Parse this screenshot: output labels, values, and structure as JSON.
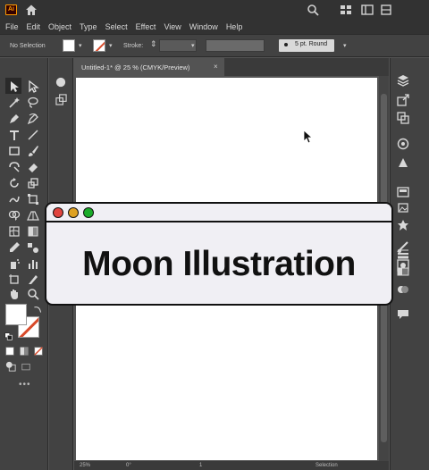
{
  "app": {
    "logo": "Ai"
  },
  "menu": [
    "File",
    "Edit",
    "Object",
    "Type",
    "Select",
    "Effect",
    "View",
    "Window",
    "Help"
  ],
  "control": {
    "selection_status": "No Selection",
    "stroke_label": "Stroke:",
    "brush_profile": "5 pt. Round"
  },
  "document": {
    "tab_title": "Untitled-1* @ 25 % (CMYK/Preview)",
    "close": "×"
  },
  "status": {
    "zoom": "25%",
    "rotation": "0°",
    "artboard_number": "1",
    "tool": "Selection"
  },
  "overlay": {
    "title": "Moon Illustration",
    "dot_colors": [
      "#e0443e",
      "#dea123",
      "#1aab29"
    ]
  },
  "colors": {
    "fill": "#ffffff",
    "stroke_slash": "#d84a2a",
    "ui_dark": "#323232",
    "ui_panel": "#424242",
    "canvas": "#535353"
  },
  "icons": {
    "titlebar_right": [
      "search-icon",
      "arrange-documents-icon",
      "workspace-icon",
      "arrange-icon"
    ],
    "tools": [
      "selection-tool-icon",
      "direct-selection-tool-icon",
      "magic-wand-tool-icon",
      "lasso-tool-icon",
      "pen-tool-icon",
      "curvature-tool-icon",
      "type-tool-icon",
      "line-segment-tool-icon",
      "rectangle-tool-icon",
      "paintbrush-tool-icon",
      "shaper-tool-icon",
      "eraser-tool-icon",
      "rotate-tool-icon",
      "scale-tool-icon",
      "warp-tool-icon",
      "free-transform-tool-icon",
      "shape-builder-tool-icon",
      "perspective-grid-tool-icon",
      "mesh-tool-icon",
      "gradient-tool-icon",
      "eyedropper-tool-icon",
      "blend-tool-icon",
      "symbol-sprayer-tool-icon",
      "column-graph-tool-icon",
      "artboard-tool-icon",
      "slice-tool-icon",
      "hand-tool-icon",
      "zoom-tool-icon"
    ],
    "right_panel": [
      "layers-icon",
      "export-icon",
      "transform-icon",
      "libraries-icon",
      "properties-icon",
      "color-guide-icon",
      "image-trace-icon",
      "symbols-icon",
      "brushes-icon",
      "graphic-styles-icon",
      "stroke-icon",
      "gradient-icon",
      "transparency-icon",
      "appearance-icon",
      "comments-icon"
    ]
  }
}
